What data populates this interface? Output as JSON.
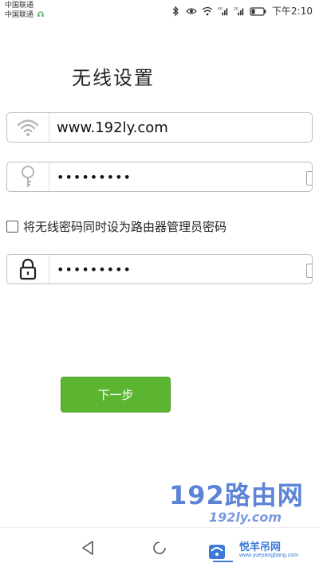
{
  "status_bar": {
    "carrier1": "中国联通",
    "carrier2": "中国联通",
    "time": "下午2:10",
    "signal1_tag": "4G",
    "signal2_tag": "2G"
  },
  "page": {
    "title": "无线设置"
  },
  "form": {
    "ssid_value": "www.192ly.com",
    "wifi_password_value": "•••••••••",
    "checkbox_label": "将无线密码同时设为路由器管理员密码",
    "admin_password_value": "•••••••••"
  },
  "actions": {
    "next_label": "下一步"
  },
  "watermark": {
    "line1": "192路由网",
    "line2": "192ly.com",
    "logo_text": "悦羊吊网",
    "logo_url": "www.yueyangbang.com"
  },
  "colors": {
    "primary_button": "#5cb531",
    "watermark": "#3f6fd1"
  }
}
